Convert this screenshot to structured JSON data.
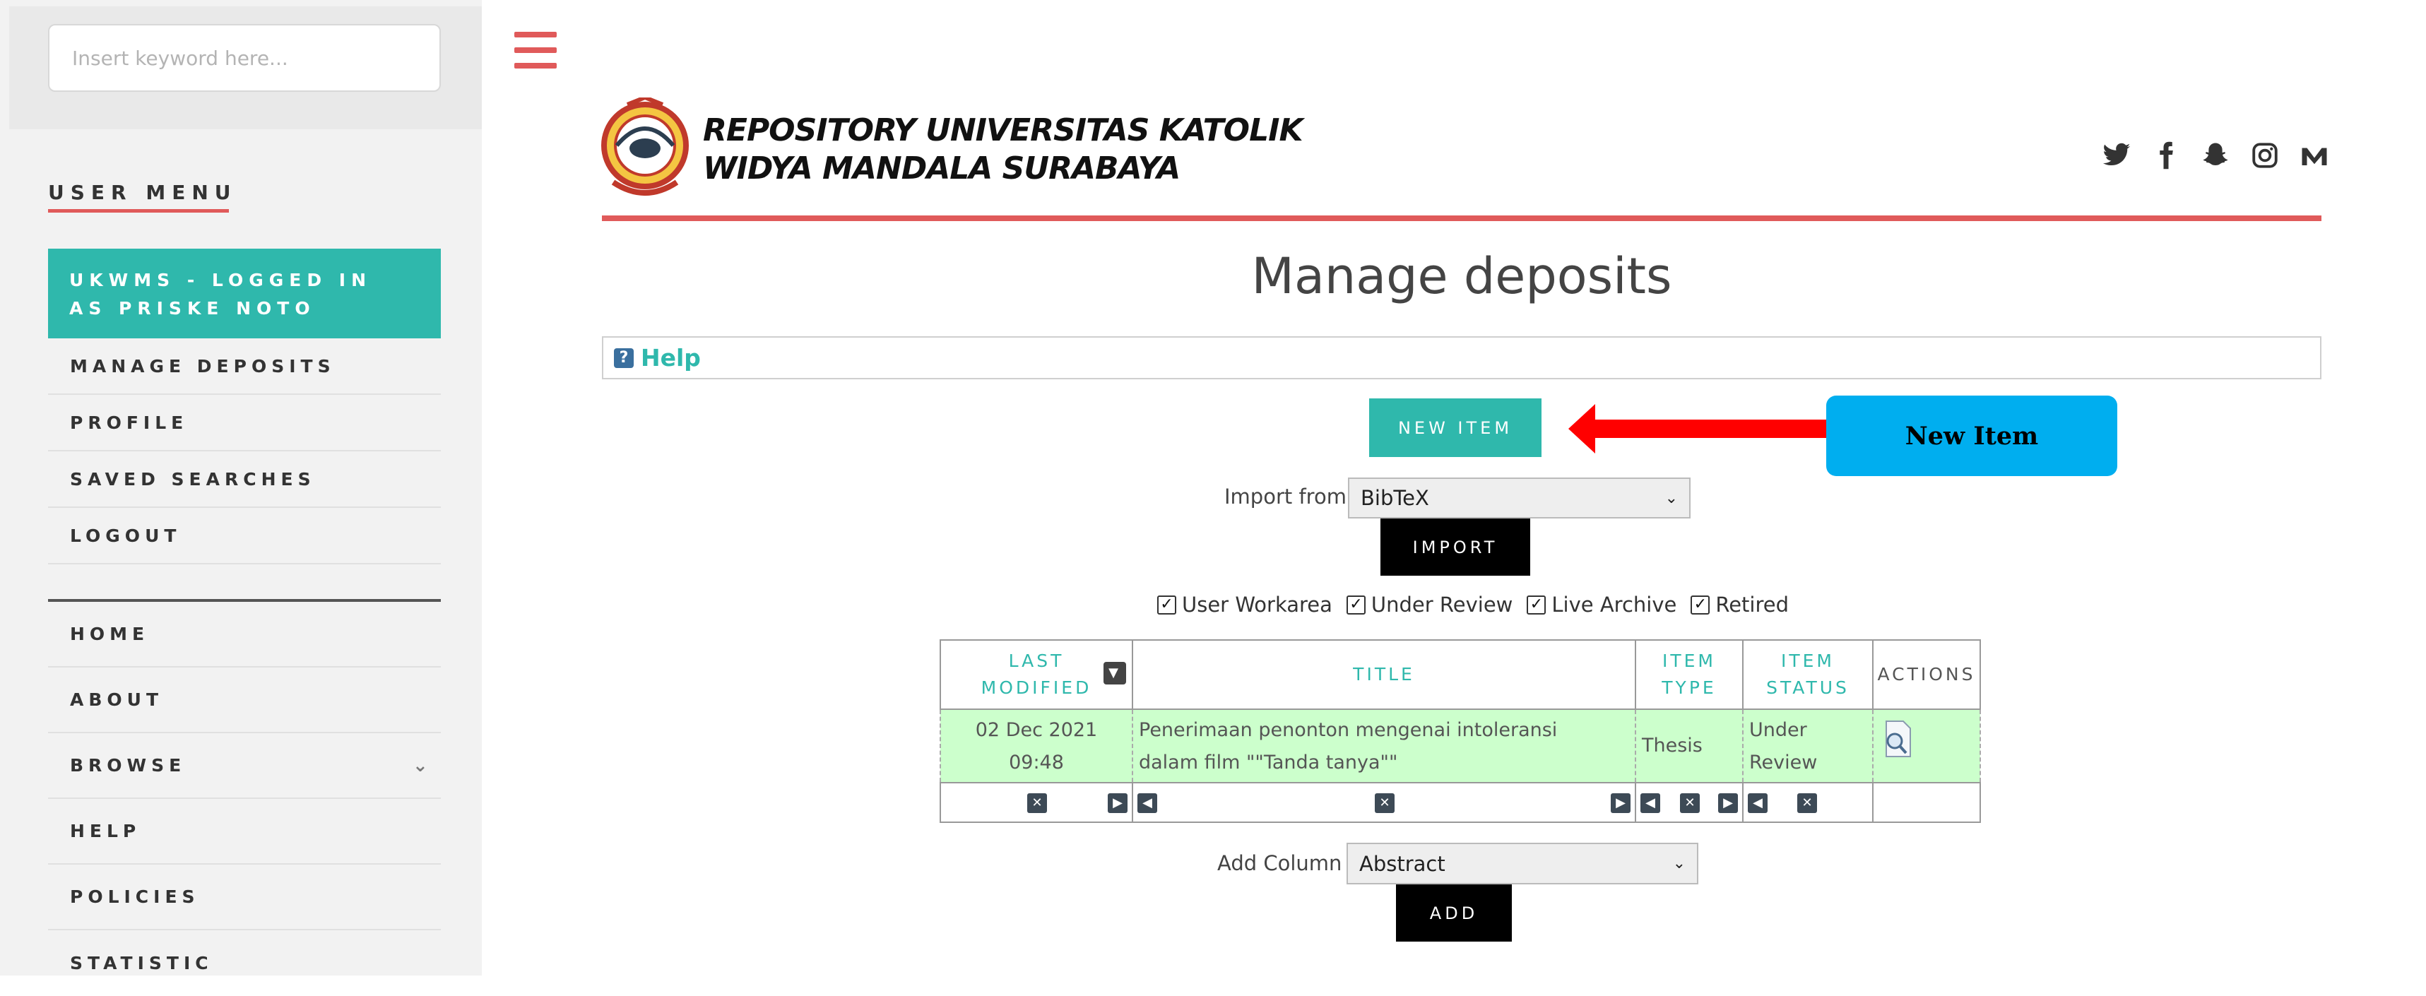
{
  "search": {
    "placeholder": "Insert keyword here..."
  },
  "sidebar": {
    "user_menu_title": "USER MENU",
    "logged_in_text": "UKWMS - LOGGED IN AS PRISKE NOTO",
    "user_items": [
      {
        "label": "MANAGE DEPOSITS"
      },
      {
        "label": "PROFILE"
      },
      {
        "label": "SAVED SEARCHES"
      },
      {
        "label": "LOGOUT"
      }
    ],
    "main_items": [
      {
        "label": "HOME",
        "has_submenu": false
      },
      {
        "label": "ABOUT",
        "has_submenu": false
      },
      {
        "label": "BROWSE",
        "has_submenu": true
      },
      {
        "label": "HELP",
        "has_submenu": false
      },
      {
        "label": "POLICIES",
        "has_submenu": false
      },
      {
        "label": "STATISTIC",
        "has_submenu": false
      }
    ]
  },
  "header": {
    "title_line1": "REPOSITORY UNIVERSITAS KATOLIK",
    "title_line2": "WIDYA MANDALA SURABAYA",
    "social_icons": [
      "twitter-icon",
      "facebook-icon",
      "snapchat-icon",
      "instagram-icon",
      "medium-icon"
    ]
  },
  "main": {
    "page_title": "Manage deposits",
    "help_label": "Help",
    "new_item_label": "NEW ITEM",
    "callout_label": "New Item",
    "import_label": "Import from",
    "import_selected": "BibTeX",
    "import_button": "IMPORT",
    "filters": [
      {
        "label": "User Workarea",
        "checked": true
      },
      {
        "label": "Under Review",
        "checked": true
      },
      {
        "label": "Live Archive",
        "checked": true
      },
      {
        "label": "Retired",
        "checked": true
      }
    ],
    "table": {
      "headers": {
        "last_modified_1": "LAST",
        "last_modified_2": "MODIFIED",
        "title": "TITLE",
        "item_type_1": "ITEM",
        "item_type_2": "TYPE",
        "item_status_1": "ITEM",
        "item_status_2": "STATUS",
        "actions": "ACTIONS"
      },
      "rows": [
        {
          "date": "02 Dec 2021",
          "time": "09:48",
          "title_line1": "Penerimaan penonton mengenai intoleransi",
          "title_line2": "dalam film \"\"Tanda tanya\"\"",
          "type": "Thesis",
          "status_line1": "Under",
          "status_line2": "Review"
        }
      ]
    },
    "add_column_label": "Add Column",
    "add_column_selected": "Abstract",
    "add_button": "ADD"
  },
  "colors": {
    "accent_teal": "#2fb8ac",
    "accent_red": "#e05a5a",
    "callout_blue": "#00aeef",
    "row_green": "#ccffcc"
  }
}
